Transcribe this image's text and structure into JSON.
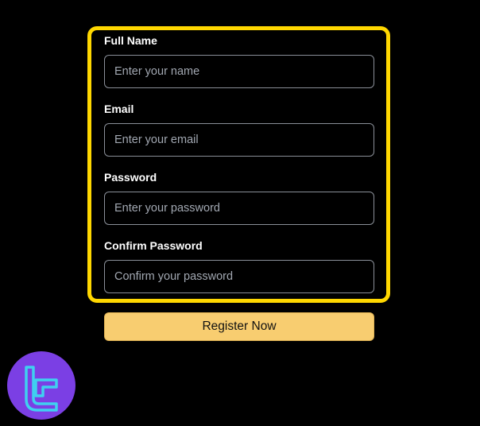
{
  "form": {
    "fields": [
      {
        "label": "Full Name",
        "placeholder": "Enter your name",
        "value": ""
      },
      {
        "label": "Email",
        "placeholder": "Enter your email",
        "value": ""
      },
      {
        "label": "Password",
        "placeholder": "Enter your password",
        "value": ""
      },
      {
        "label": "Confirm Password",
        "placeholder": "Confirm your password",
        "value": ""
      }
    ],
    "submit_label": "Register Now"
  },
  "logo": {
    "icon": "tradingfinder-logo-icon"
  },
  "colors": {
    "background": "#000000",
    "highlight_border": "#ffd700",
    "button_background": "#f8cd70",
    "logo_background": "#7b3fe4",
    "logo_glyph": "#3fd0f0"
  }
}
